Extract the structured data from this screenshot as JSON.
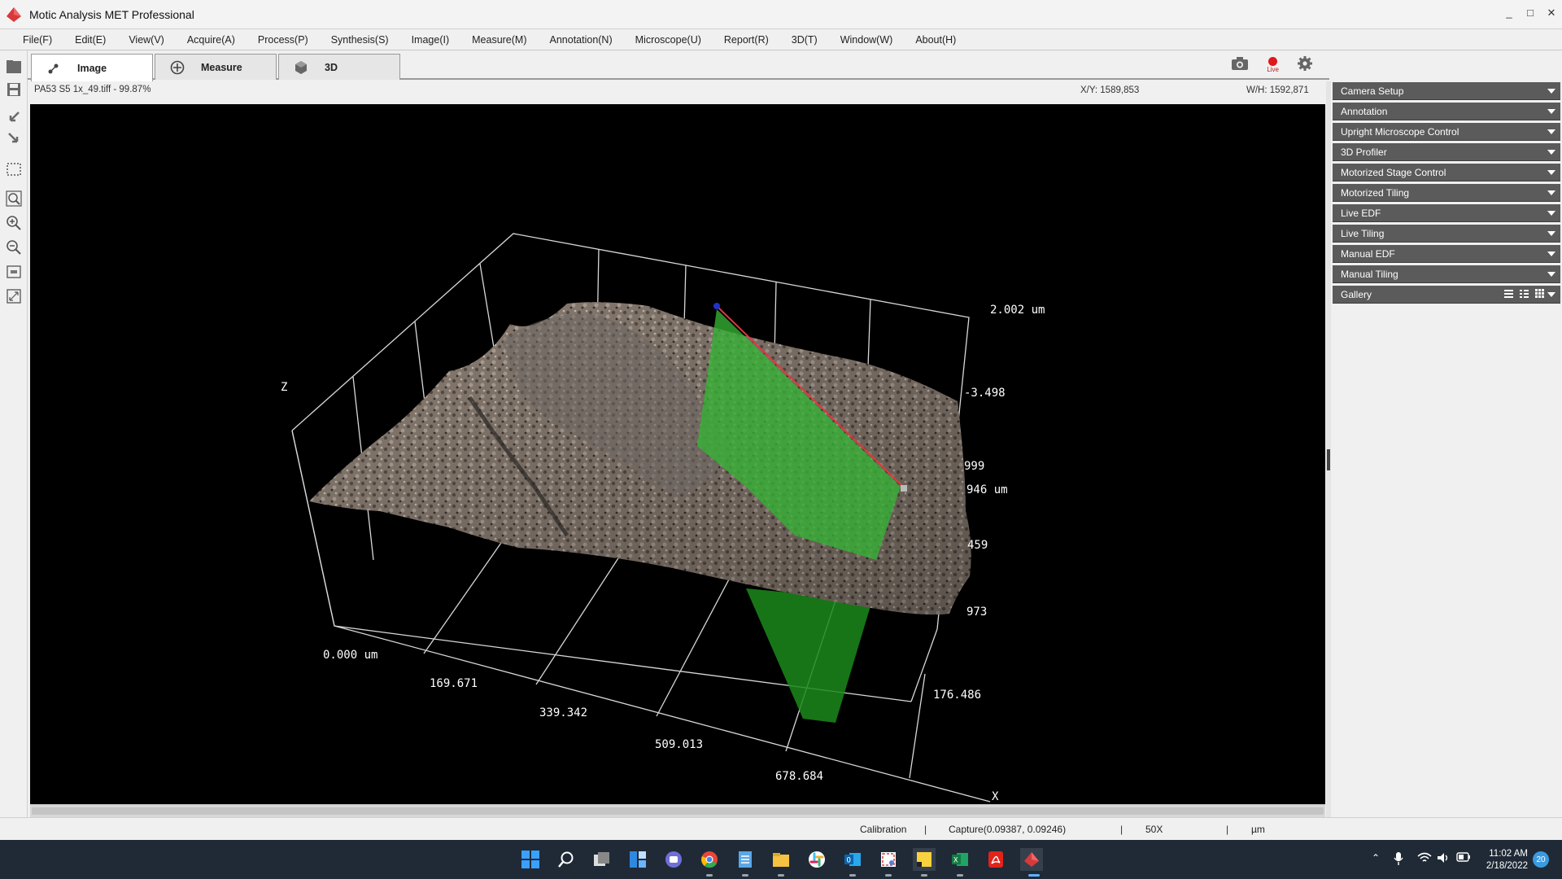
{
  "window": {
    "title": "Motic Analysis MET Professional",
    "min": "_",
    "max": "□",
    "close": "✕"
  },
  "menu": [
    "File(F)",
    "Edit(E)",
    "View(V)",
    "Acquire(A)",
    "Process(P)",
    "Synthesis(S)",
    "Image(I)",
    "Measure(M)",
    "Annotation(N)",
    "Microscope(U)",
    "Report(R)",
    "3D(T)",
    "Window(W)",
    "About(H)"
  ],
  "tabs": [
    {
      "label": "Image",
      "icon": "image-tool-icon",
      "active": true
    },
    {
      "label": "Measure",
      "icon": "measure-icon",
      "active": false
    },
    {
      "label": "3D",
      "icon": "cube-icon",
      "active": false
    }
  ],
  "toolbar_right": {
    "camera_icon": "camera-icon",
    "live_label": "Live",
    "settings_icon": "gear-icon"
  },
  "info": {
    "file_name": "PA53 S5 1x_49.tiff - 99.87%",
    "xy": "X/Y: 1589,853",
    "wh": "W/H: 1592,871"
  },
  "plot": {
    "z_axis": "Z",
    "x_axis": "X",
    "z_top": "2.002 um",
    "z_mid": "-3.498",
    "y_labels": [
      "999",
      "946 um",
      "459",
      "973"
    ],
    "x_origin": "0.000 um",
    "x_ticks": [
      "169.671",
      "339.342",
      "509.013",
      "678.684"
    ],
    "y_end": "176.486"
  },
  "right_panel": [
    "Camera Setup",
    "Annotation",
    "Upright Microscope Control",
    "3D Profiler",
    "Motorized Stage Control",
    "Motorized Tiling",
    "Live EDF",
    "Live Tiling",
    "Manual EDF",
    "Manual Tiling",
    "Gallery"
  ],
  "status": {
    "calibration": "Calibration",
    "capture": "Capture(0.09387, 0.09246)",
    "magnification": "50X",
    "unit": "µm",
    "separator": "|"
  },
  "taskbar": {
    "icons": [
      "windows-start-icon",
      "search-icon",
      "task-view-icon",
      "widgets-icon",
      "teams-chat-icon",
      "chrome-icon",
      "notepad-icon",
      "file-explorer-icon",
      "slack-icon",
      "outlook-icon",
      "snipping-tool-icon",
      "sticky-notes-icon",
      "excel-icon",
      "acrobat-icon",
      "motic-icon"
    ],
    "time": "11:02 AM",
    "date": "2/18/2022",
    "notifications": "20"
  },
  "colors": {
    "accent_red": "#e0393b",
    "panel_dark": "#5b5b5b",
    "taskbar": "#1f2a36",
    "profile_green": "#2fa82f"
  }
}
